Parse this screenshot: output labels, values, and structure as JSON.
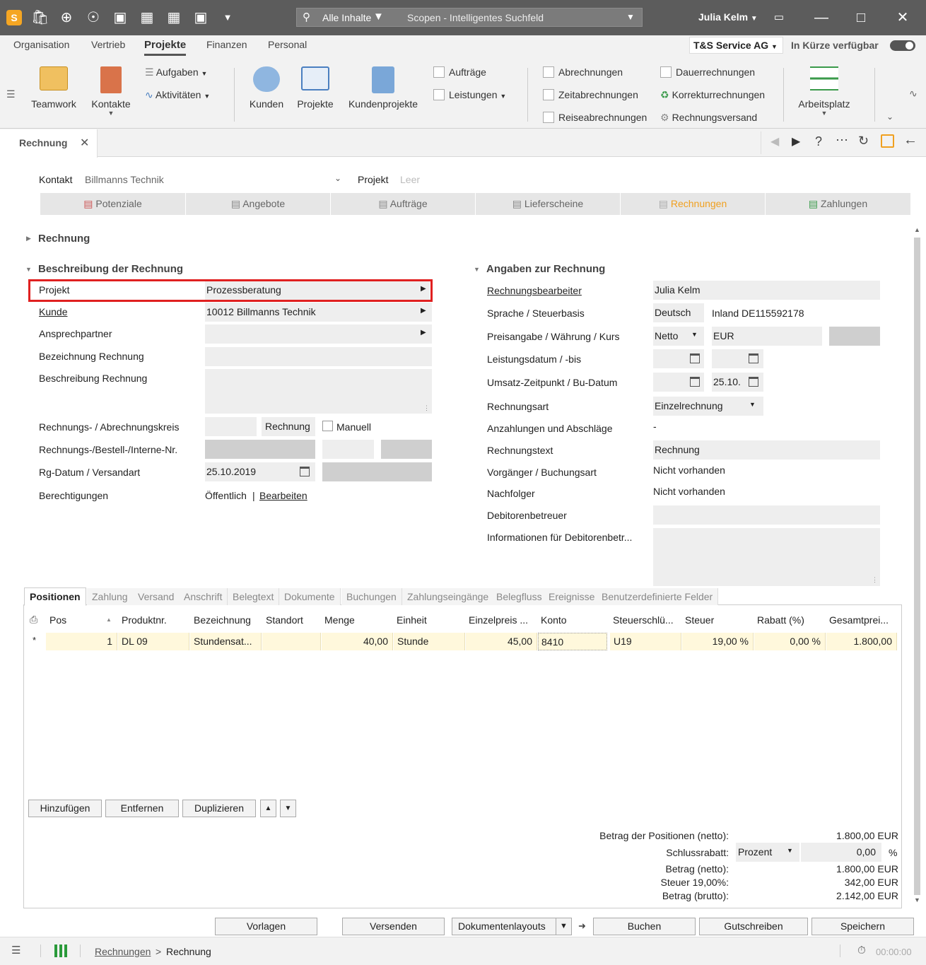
{
  "titlebar": {
    "search_scope": "Alle Inhalte",
    "search_placeholder": "Scopen - Intelligentes Suchfeld",
    "user": "Julia Kelm",
    "logo_letter": "S"
  },
  "menubar": {
    "items": [
      "Organisation",
      "Vertrieb",
      "Projekte",
      "Finanzen",
      "Personal"
    ],
    "company": "T&S Service AG",
    "coming_soon": "In Kürze verfügbar"
  },
  "ribbon": {
    "teamwork": "Teamwork",
    "kontakte": "Kontakte",
    "aufgaben": "Aufgaben",
    "aktivitaeten": "Aktivitäten",
    "kunden": "Kunden",
    "projekte": "Projekte",
    "kundenprojekte": "Kundenprojekte",
    "auftraege": "Aufträge",
    "leistungen": "Leistungen",
    "abrechnungen": "Abrechnungen",
    "zeitabrechnungen": "Zeitabrechnungen",
    "reiseabrechnungen": "Reiseabrechnungen",
    "dauerrechnungen": "Dauerrechnungen",
    "korrekturrechnungen": "Korrekturrechnungen",
    "rechnungsversand": "Rechnungsversand",
    "arbeitsplatz": "Arbeitsplatz"
  },
  "tab": {
    "title": "Rechnung"
  },
  "context": {
    "kontakt_label": "Kontakt",
    "kontakt_value": "Billmanns Technik",
    "projekt_label": "Projekt",
    "projekt_value": "Leer"
  },
  "steps": [
    "Potenziale",
    "Angebote",
    "Aufträge",
    "Lieferscheine",
    "Rechnungen",
    "Zahlungen"
  ],
  "sections": {
    "rechnung": "Rechnung",
    "beschreibung": "Beschreibung der Rechnung",
    "angaben": "Angaben zur Rechnung"
  },
  "left": {
    "projekt_l": "Projekt",
    "projekt_v": "Prozessberatung",
    "kunde_l": "Kunde",
    "kunde_v": "10012 Billmanns Technik",
    "ansprech_l": "Ansprechpartner",
    "bez_l": "Bezeichnung Rechnung",
    "beschr_l": "Beschreibung Rechnung",
    "kreis_l": "Rechnungs- / Abrechnungskreis",
    "kreis_v": "Rechnung",
    "manuell": "Manuell",
    "nr_l": "Rechnungs-/Bestell-/Interne-Nr.",
    "datum_l": "Rg-Datum / Versandart",
    "datum_v": "25.10.2019",
    "ber_l": "Berechtigungen",
    "ber_v": "Öffentlich",
    "ber_sep": "|",
    "ber_link": "Bearbeiten"
  },
  "right": {
    "bearb_l": "Rechnungsbearbeiter",
    "bearb_v": "Julia Kelm",
    "sprache_l": "Sprache / Steuerbasis",
    "sprache_v": "Deutsch",
    "steuer_v": "Inland DE115592178",
    "preis_l": "Preisangabe / Währung / Kurs",
    "preis_v": "Netto",
    "waehr_v": "EUR",
    "leist_l": "Leistungsdatum / -bis",
    "umsatz_l": "Umsatz-Zeitpunkt / Bu-Datum",
    "bu_v": "25.10.",
    "art_l": "Rechnungsart",
    "art_v": "Einzelrechnung",
    "anz_l": "Anzahlungen und Abschläge",
    "anz_v": "-",
    "text_l": "Rechnungstext",
    "text_v": "Rechnung",
    "vorg_l": "Vorgänger / Buchungsart",
    "vorg_v": "Nicht vorhanden",
    "nach_l": "Nachfolger",
    "nach_v": "Nicht vorhanden",
    "debi_l": "Debitorenbetreuer",
    "info_l": "Informationen für Debitorenbetr..."
  },
  "bottom_tabs": [
    "Positionen",
    "Zahlung",
    "Versand",
    "Anschrift",
    "Belegtext",
    "Dokumente",
    "Buchungen",
    "Zahlungseingänge",
    "Belegfluss",
    "Ereignisse",
    "Benutzerdefinierte Felder"
  ],
  "grid": {
    "headers": [
      "Pos",
      "Produktnr.",
      "Bezeichnung",
      "Standort",
      "Menge",
      "Einheit",
      "Einzelpreis ...",
      "Konto",
      "Steuerschlü...",
      "Steuer",
      "Rabatt (%)",
      "Gesamtprei..."
    ],
    "row_marker": "*",
    "row": [
      "1",
      "DL 09",
      "Stundensat...",
      "",
      "40,00",
      "Stunde",
      "45,00",
      "8410",
      "U19",
      "19,00 %",
      "0,00 %",
      "1.800,00"
    ]
  },
  "grid_buttons": {
    "add": "Hinzufügen",
    "remove": "Entfernen",
    "dup": "Duplizieren"
  },
  "totals": {
    "pos_l": "Betrag der Positionen (netto):",
    "pos_v": "1.800,00 EUR",
    "rabatt_l": "Schlussrabatt:",
    "rabatt_mode": "Prozent",
    "rabatt_v": "0,00",
    "rabatt_u": "%",
    "netto_l": "Betrag (netto):",
    "netto_v": "1.800,00 EUR",
    "steuer_l": "Steuer 19,00%:",
    "steuer_v": "342,00 EUR",
    "brutto_l": "Betrag (brutto):",
    "brutto_v": "2.142,00 EUR"
  },
  "actions": {
    "vorlagen": "Vorlagen",
    "versenden": "Versenden",
    "layouts": "Dokumentenlayouts",
    "buchen": "Buchen",
    "gutschreiben": "Gutschreiben",
    "speichern": "Speichern"
  },
  "statusbar": {
    "crumb1": "Rechnungen",
    "sep": ">",
    "crumb2": "Rechnung",
    "timer": "00:00:00"
  }
}
